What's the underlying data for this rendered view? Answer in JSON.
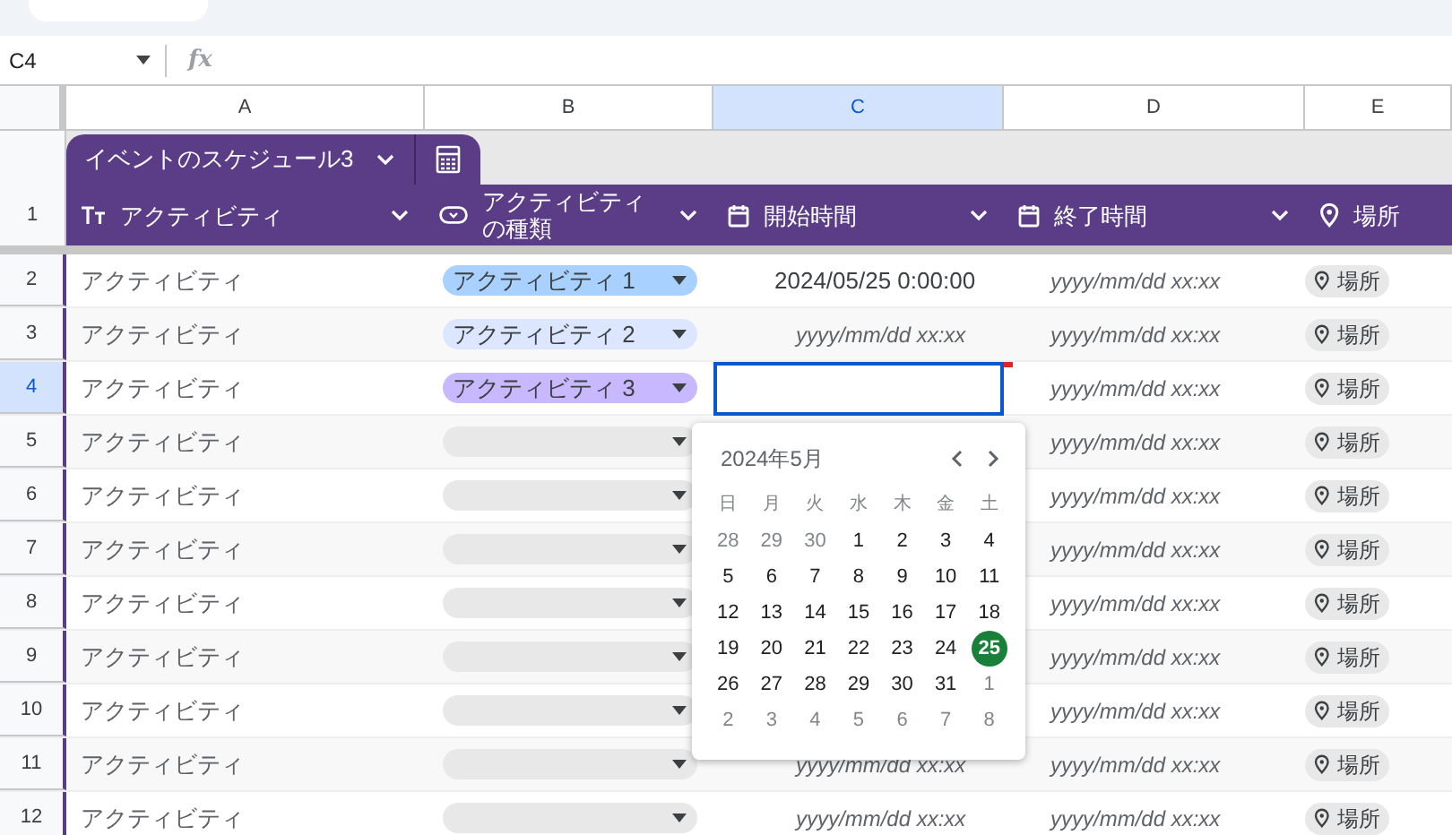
{
  "name_box": "C4",
  "formula_icon": "fx",
  "columns": [
    {
      "label": "A",
      "selected": false
    },
    {
      "label": "B",
      "selected": false
    },
    {
      "label": "C",
      "selected": true
    },
    {
      "label": "D",
      "selected": false
    },
    {
      "label": "E",
      "selected": false
    }
  ],
  "table_tab": {
    "title": "イベントのスケジュール3"
  },
  "header_row": {
    "number": "1",
    "fields": [
      {
        "kind": "text",
        "label": "アクティビティ"
      },
      {
        "kind": "dropdown",
        "label": "アクティビティの種類"
      },
      {
        "kind": "date",
        "label": "開始時間"
      },
      {
        "kind": "date",
        "label": "終了時間"
      },
      {
        "kind": "place",
        "label": "場所"
      }
    ]
  },
  "rows": [
    {
      "number": "2",
      "selected": false,
      "activity": "アクティビティ",
      "type": {
        "label": "アクティビティ 1",
        "color": "#a8d1ff"
      },
      "start": {
        "kind": "value",
        "text": "2024/05/25 0:00:00"
      },
      "end": "yyyy/mm/dd xx:xx",
      "place": "場所"
    },
    {
      "number": "3",
      "selected": false,
      "activity": "アクティビティ",
      "type": {
        "label": "アクティビティ 2",
        "color": "#dde6ff"
      },
      "start": {
        "kind": "placeholder",
        "text": "yyyy/mm/dd xx:xx"
      },
      "end": "yyyy/mm/dd xx:xx",
      "place": "場所"
    },
    {
      "number": "4",
      "selected": true,
      "activity": "アクティビティ",
      "type": {
        "label": "アクティビティ 3",
        "color": "#c7b8ff"
      },
      "start": {
        "kind": "editing"
      },
      "end": "yyyy/mm/dd xx:xx",
      "place": "場所"
    },
    {
      "number": "5",
      "selected": false,
      "activity": "アクティビティ",
      "type": {
        "color": "#e8e8e8"
      },
      "start": {
        "kind": "hidden"
      },
      "end": "yyyy/mm/dd xx:xx",
      "place": "場所"
    },
    {
      "number": "6",
      "selected": false,
      "activity": "アクティビティ",
      "type": {
        "color": "#e8e8e8"
      },
      "start": {
        "kind": "hidden"
      },
      "end": "yyyy/mm/dd xx:xx",
      "place": "場所"
    },
    {
      "number": "7",
      "selected": false,
      "activity": "アクティビティ",
      "type": {
        "color": "#e8e8e8"
      },
      "start": {
        "kind": "hidden"
      },
      "end": "yyyy/mm/dd xx:xx",
      "place": "場所"
    },
    {
      "number": "8",
      "selected": false,
      "activity": "アクティビティ",
      "type": {
        "color": "#e8e8e8"
      },
      "start": {
        "kind": "hidden"
      },
      "end": "yyyy/mm/dd xx:xx",
      "place": "場所"
    },
    {
      "number": "9",
      "selected": false,
      "activity": "アクティビティ",
      "type": {
        "color": "#e8e8e8"
      },
      "start": {
        "kind": "hidden"
      },
      "end": "yyyy/mm/dd xx:xx",
      "place": "場所"
    },
    {
      "number": "10",
      "selected": false,
      "activity": "アクティビティ",
      "type": {
        "color": "#e8e8e8"
      },
      "start": {
        "kind": "hidden"
      },
      "end": "yyyy/mm/dd xx:xx",
      "place": "場所"
    },
    {
      "number": "11",
      "selected": false,
      "activity": "アクティビティ",
      "type": {
        "color": "#e8e8e8"
      },
      "start": {
        "kind": "placeholder",
        "text": "yyyy/mm/dd xx:xx"
      },
      "end": "yyyy/mm/dd xx:xx",
      "place": "場所"
    },
    {
      "number": "12",
      "selected": false,
      "activity": "アクティビティ",
      "type": {
        "color": "#e8e8e8"
      },
      "start": {
        "kind": "placeholder",
        "text": "yyyy/mm/dd xx:xx"
      },
      "end": "yyyy/mm/dd xx:xx",
      "place": "場所"
    }
  ],
  "calendar": {
    "title": "2024年5月",
    "weekdays": [
      "日",
      "月",
      "火",
      "水",
      "木",
      "金",
      "土"
    ],
    "weeks": [
      [
        {
          "day": "28",
          "kind": "other",
          "selected": false
        },
        {
          "day": "29",
          "kind": "other",
          "selected": false
        },
        {
          "day": "30",
          "kind": "other",
          "selected": false
        },
        {
          "day": "1",
          "kind": "current",
          "selected": false
        },
        {
          "day": "2",
          "kind": "current",
          "selected": false
        },
        {
          "day": "3",
          "kind": "current",
          "selected": false
        },
        {
          "day": "4",
          "kind": "current",
          "selected": false
        }
      ],
      [
        {
          "day": "5",
          "kind": "current",
          "selected": false
        },
        {
          "day": "6",
          "kind": "current",
          "selected": false
        },
        {
          "day": "7",
          "kind": "current",
          "selected": false
        },
        {
          "day": "8",
          "kind": "current",
          "selected": false
        },
        {
          "day": "9",
          "kind": "current",
          "selected": false
        },
        {
          "day": "10",
          "kind": "current",
          "selected": false
        },
        {
          "day": "11",
          "kind": "current",
          "selected": false
        }
      ],
      [
        {
          "day": "12",
          "kind": "current",
          "selected": false
        },
        {
          "day": "13",
          "kind": "current",
          "selected": false
        },
        {
          "day": "14",
          "kind": "current",
          "selected": false
        },
        {
          "day": "15",
          "kind": "current",
          "selected": false
        },
        {
          "day": "16",
          "kind": "current",
          "selected": false
        },
        {
          "day": "17",
          "kind": "current",
          "selected": false
        },
        {
          "day": "18",
          "kind": "current",
          "selected": false
        }
      ],
      [
        {
          "day": "19",
          "kind": "current",
          "selected": false
        },
        {
          "day": "20",
          "kind": "current",
          "selected": false
        },
        {
          "day": "21",
          "kind": "current",
          "selected": false
        },
        {
          "day": "22",
          "kind": "current",
          "selected": false
        },
        {
          "day": "23",
          "kind": "current",
          "selected": false
        },
        {
          "day": "24",
          "kind": "current",
          "selected": false
        },
        {
          "day": "25",
          "kind": "current",
          "selected": true
        }
      ],
      [
        {
          "day": "26",
          "kind": "current",
          "selected": false
        },
        {
          "day": "27",
          "kind": "current",
          "selected": false
        },
        {
          "day": "28",
          "kind": "current",
          "selected": false
        },
        {
          "day": "29",
          "kind": "current",
          "selected": false
        },
        {
          "day": "30",
          "kind": "current",
          "selected": false
        },
        {
          "day": "31",
          "kind": "current",
          "selected": false
        },
        {
          "day": "1",
          "kind": "other",
          "selected": false
        }
      ],
      [
        {
          "day": "2",
          "kind": "other",
          "selected": false
        },
        {
          "day": "3",
          "kind": "other",
          "selected": false
        },
        {
          "day": "4",
          "kind": "other",
          "selected": false
        },
        {
          "day": "5",
          "kind": "other",
          "selected": false
        },
        {
          "day": "6",
          "kind": "other",
          "selected": false
        },
        {
          "day": "7",
          "kind": "other",
          "selected": false
        },
        {
          "day": "8",
          "kind": "other",
          "selected": false
        }
      ]
    ]
  }
}
